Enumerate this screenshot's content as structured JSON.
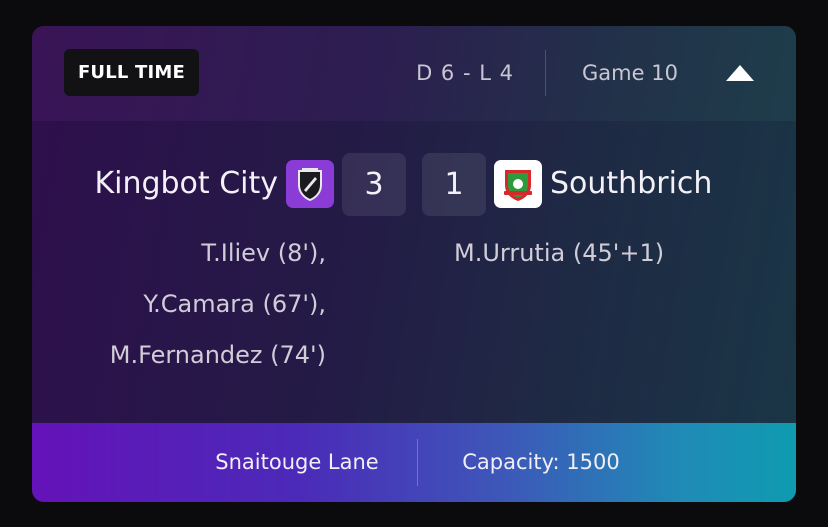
{
  "match": {
    "status": "FULL TIME",
    "record": "D 6 - L 4",
    "game": "Game 10",
    "collapse_icon": "chevron-up-icon"
  },
  "home": {
    "name": "Kingbot City",
    "score": "3",
    "crest_color": "#8b3bd6",
    "scorers": [
      "T.Iliev (8'),",
      "Y.Camara (67'),",
      "M.Fernandez (74')"
    ]
  },
  "away": {
    "name": "Southbrich",
    "score": "1",
    "crest_color": "#ffffff",
    "scorers": [
      "M.Urrutia (45'+1)"
    ]
  },
  "footer": {
    "venue": "Snaitouge Lane",
    "capacity": "Capacity: 1500"
  }
}
